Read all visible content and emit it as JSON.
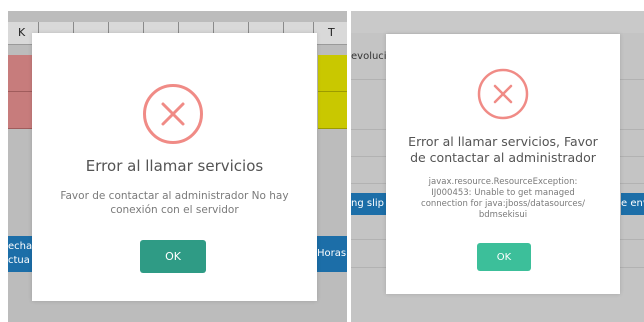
{
  "colors": {
    "error_ring": "#f08b86",
    "ok_left": "#2f9b85",
    "ok_right": "#3cbf9a",
    "blue_button": "#1c6ea8",
    "red_cell": "#c77c7c",
    "yellow_cell": "#c9c800"
  },
  "left_panel": {
    "col_k": "K",
    "col_t": "T",
    "button_left_line1": "echa",
    "button_left_line2": "ctua",
    "button_right": "Horas"
  },
  "right_panel": {
    "header_fragment": "evolucio",
    "button_left": "ng slip",
    "button_right": "e env"
  },
  "dialog_left": {
    "icon": "error-x-circle-icon",
    "title": "Error al llamar servicios",
    "message": "Favor de contactar al administrador No hay conexión con el servidor",
    "ok_label": "OK"
  },
  "dialog_right": {
    "icon": "error-x-circle-icon",
    "title": "Error al llamar servicios, Favor de contactar al administrador",
    "message": "javax.resource.ResourceException: IJ000453: Unable to get managed connection for java:jboss/datasources/ bdmsekisui",
    "ok_label": "OK"
  }
}
